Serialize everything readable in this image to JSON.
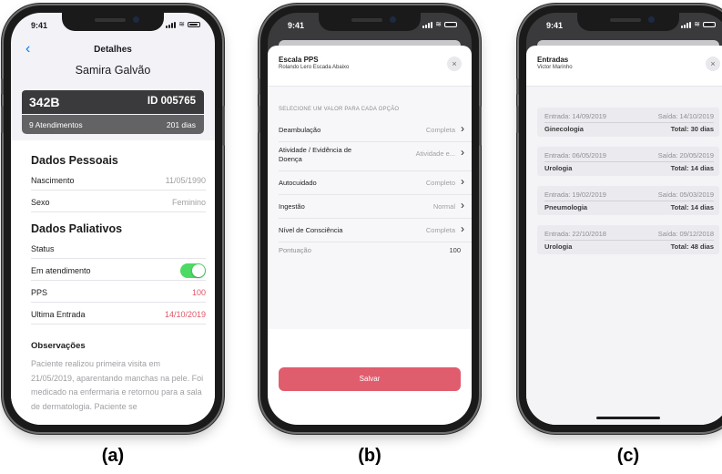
{
  "status_time": "9:41",
  "phone_a": {
    "nav_title": "Detalhes",
    "patient_name": "Samira Galvão",
    "bed": "342B",
    "patient_id": "ID 005765",
    "attendances": "9 Atendimentos",
    "days": "201 dias",
    "personal_title": "Dados Pessoais",
    "personal_rows": [
      {
        "label": "Nascimento",
        "value": "11/05/1990"
      },
      {
        "label": "Sexo",
        "value": "Feminino"
      }
    ],
    "palliative_title": "Dados Paliativos",
    "status_label": "Status",
    "status_row": {
      "label": "Em atendimento",
      "toggle_on": true
    },
    "pps_row": {
      "label": "PPS",
      "value": "100"
    },
    "last_entry_row": {
      "label": "Ultima Entrada",
      "value": "14/10/2019"
    },
    "observations_title": "Observações",
    "observations_text": "Paciente realizou primeira visita em 21/05/2019, aparentando manchas na pele. Foi medicado na enfermaria e retornou para a sala de dermatologia. Paciente se"
  },
  "phone_b": {
    "title": "Escala PPS",
    "subtitle": "Rolando Lero Escada Abaixo",
    "close_icon": "×",
    "section_header": "SELECIONE UM VALOR PARA CADA OPÇÃO",
    "items": [
      {
        "label": "Deambulação",
        "value": "Completa"
      },
      {
        "label": "Atividade / Evidência de Doença",
        "value": "Atividade e..."
      },
      {
        "label": "Autocuidado",
        "value": "Completo"
      },
      {
        "label": "Ingestão",
        "value": "Normal"
      },
      {
        "label": "Nível de Consciência",
        "value": "Completa"
      }
    ],
    "score_label": "Pontuação",
    "score_value": "100",
    "save_label": "Salvar"
  },
  "phone_c": {
    "title": "Entradas",
    "subtitle": "Victor Marinho",
    "close_icon": "×",
    "entries": [
      {
        "entrada": "Entrada: 14/09/2019",
        "saida": "Saída: 14/10/2019",
        "specialty": "Ginecologia",
        "total": "Total: 30 dias"
      },
      {
        "entrada": "Entrada: 06/05/2019",
        "saida": "Saída: 20/05/2019",
        "specialty": "Urologia",
        "total": "Total: 14 dias"
      },
      {
        "entrada": "Entrada: 19/02/2019",
        "saida": "Saída: 05/03/2019",
        "specialty": "Pneumologia",
        "total": "Total: 14 dias"
      },
      {
        "entrada": "Entrada: 22/10/2018",
        "saida": "Saída: 09/12/2018",
        "specialty": "Urologia",
        "total": "Total: 48 dias"
      }
    ]
  },
  "captions": [
    "(a)",
    "(b)",
    "(c)"
  ],
  "colors": {
    "accent_red": "#e05d6e",
    "toggle_green": "#4cd964",
    "link_blue": "#007aff",
    "dark_header": "#3a3a3c"
  }
}
